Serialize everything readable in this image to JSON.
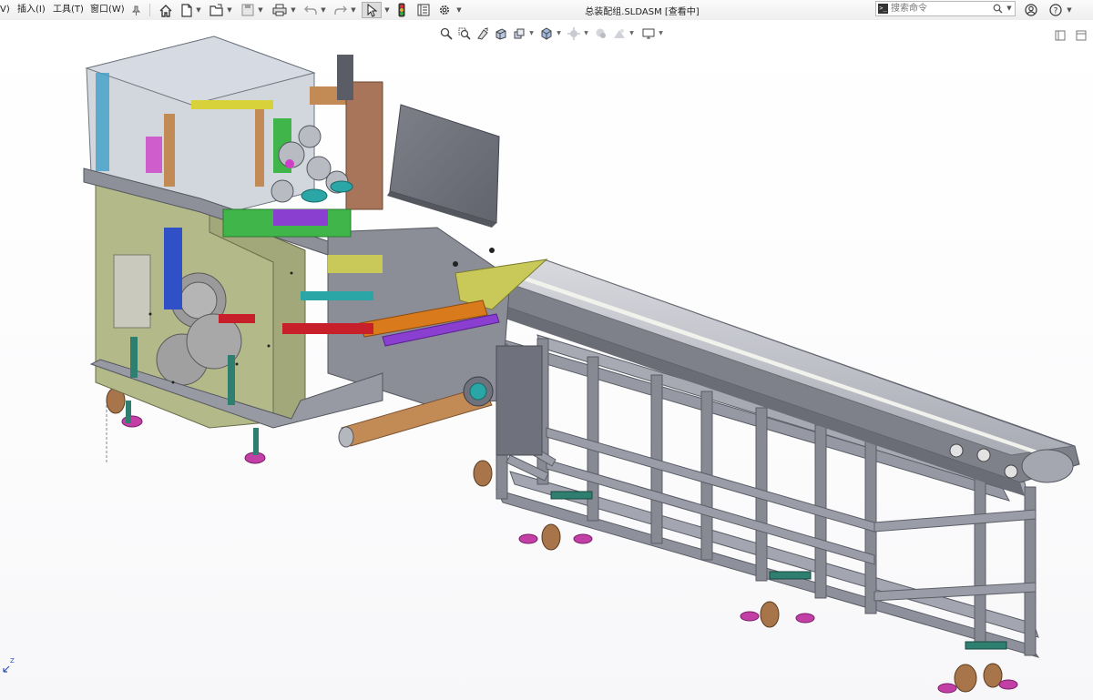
{
  "menu": {
    "view": "V)",
    "insert": "插入(I)",
    "tools": "工具(T)",
    "window": "窗口(W)"
  },
  "document": {
    "title": "总装配组.SLDASM [查看中]"
  },
  "search": {
    "placeholder": "搜索命令"
  },
  "triad": {
    "axis_label": "Z"
  },
  "icons": {
    "pin": "pin-icon",
    "home": "home-icon",
    "new": "new-document-icon",
    "open": "open-folder-icon",
    "save": "save-icon",
    "print": "print-icon",
    "undo": "undo-icon",
    "redo": "redo-icon",
    "select": "select-pointer-icon",
    "rebuild": "rebuild-traffic-light-icon",
    "file_properties": "file-properties-icon",
    "options": "gear-icon",
    "help": "help-icon",
    "user": "user-icon"
  },
  "colors": {
    "frame": "#8e909c",
    "frame_dark": "#6f717c",
    "olive_panel": "#b4b98a",
    "glass": "#c3c8d2",
    "caster_wheel": "#a8754a",
    "foot_pad": "#c23fa6",
    "copper_shaft": "#c28a55",
    "orange": "#d97a1c",
    "purple": "#8a3fd0",
    "teal": "#2aa6a6",
    "green": "#3fb54a",
    "yellow": "#d8d23a",
    "magenta": "#d03fc8",
    "red": "#c8202a"
  }
}
